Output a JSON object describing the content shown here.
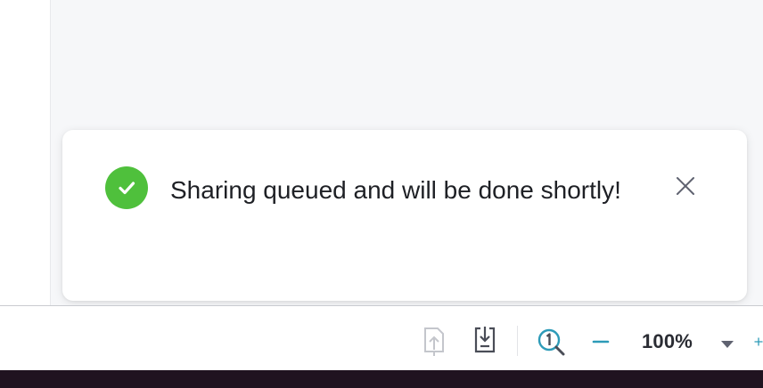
{
  "toast": {
    "message": "Sharing queued and will be done shortly!",
    "status": "success",
    "icon": "check-circle-icon",
    "close_icon": "close-icon"
  },
  "toolbar": {
    "upload_icon": "upload-disabled-icon",
    "download_icon": "download-icon",
    "zoom_fit_icon": "zoom-one-to-one-icon",
    "zoom_out_icon": "minus-icon",
    "zoom_level": "100%",
    "zoom_dropdown_icon": "caret-down-icon",
    "zoom_in_icon": "plus-icon"
  },
  "colors": {
    "success": "#4fc03c",
    "accent": "#2d9bb8",
    "toolbar_icon": "#4a4d57",
    "disabled_icon": "#c4c6cc",
    "bottom_strip": "#201320"
  }
}
